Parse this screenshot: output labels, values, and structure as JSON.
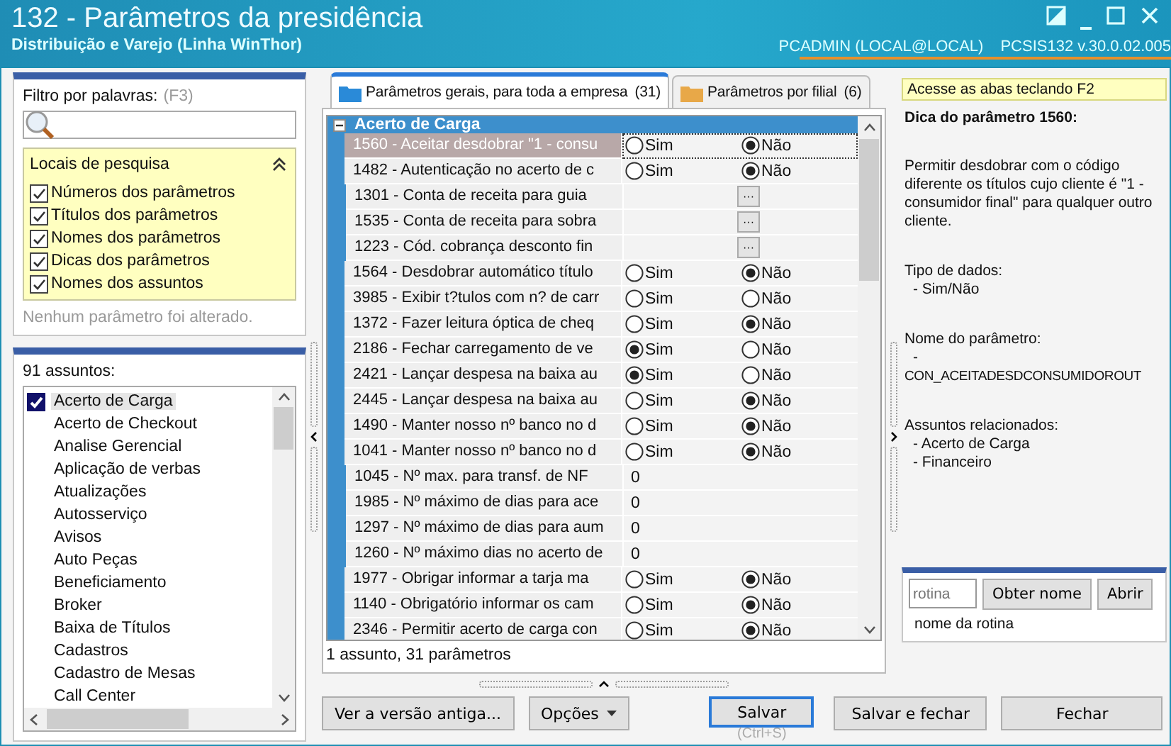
{
  "window": {
    "title": "132 - Parâmetros da presidência",
    "subtitle": "Distribuição e Varejo (Linha WinThor)",
    "user": "PCADMIN (LOCAL@LOCAL)",
    "program": "PCSIS132  v.30.0.02.005"
  },
  "filter": {
    "label": "Filtro por palavras:",
    "shortcut": "(F3)",
    "search_places": {
      "title": "Locais de pesquisa",
      "expanded": true,
      "options": [
        {
          "label": "Números dos parâmetros",
          "checked": true
        },
        {
          "label": "Títulos dos parâmetros",
          "checked": true
        },
        {
          "label": "Nomes dos parâmetros",
          "checked": true
        },
        {
          "label": "Dicas dos parâmetros",
          "checked": true
        },
        {
          "label": "Nomes dos assuntos",
          "checked": true
        }
      ]
    },
    "status": "Nenhum parâmetro foi alterado."
  },
  "subjects": {
    "count_label": "91 assuntos:",
    "items": [
      {
        "label": "Acerto de Carga",
        "checked": true,
        "selected": true
      },
      {
        "label": "Acerto de Checkout",
        "checked": false,
        "selected": false
      },
      {
        "label": "Analise Gerencial",
        "checked": false,
        "selected": false
      },
      {
        "label": "Aplicação de verbas",
        "checked": false,
        "selected": false
      },
      {
        "label": "Atualizações",
        "checked": false,
        "selected": false
      },
      {
        "label": "Autosserviço",
        "checked": false,
        "selected": false
      },
      {
        "label": "Avisos",
        "checked": false,
        "selected": false
      },
      {
        "label": "Auto Peças",
        "checked": false,
        "selected": false
      },
      {
        "label": "Beneficiamento",
        "checked": false,
        "selected": false
      },
      {
        "label": "Broker",
        "checked": false,
        "selected": false
      },
      {
        "label": "Baixa de Títulos",
        "checked": false,
        "selected": false
      },
      {
        "label": "Cadastros",
        "checked": false,
        "selected": false
      },
      {
        "label": "Cadastro de Mesas",
        "checked": false,
        "selected": false
      },
      {
        "label": "Call Center",
        "checked": false,
        "selected": false
      }
    ]
  },
  "tabs": [
    {
      "label": "Parâmetros gerais, para toda a empresa",
      "count": "(31)",
      "selected": true
    },
    {
      "label": "Parâmetros por filial",
      "count": "(6)",
      "selected": false
    }
  ],
  "grid": {
    "group": "Acerto de Carga",
    "expanded": true,
    "rows": [
      {
        "label": "1560 - Aceitar desdobrar \"1 - consu",
        "kind": "bool",
        "selected": true,
        "options": [
          {
            "label": "Sim",
            "selected": false
          },
          {
            "label": "Não",
            "selected": true
          }
        ]
      },
      {
        "label": "1482 - Autenticação no acerto de c",
        "kind": "bool",
        "selected": false,
        "options": [
          {
            "label": "Sim",
            "selected": false
          },
          {
            "label": "Não",
            "selected": true
          }
        ]
      },
      {
        "label": "1301 - Conta de receita para guia",
        "kind": "lookup",
        "selected": false,
        "button": "···"
      },
      {
        "label": "1535 - Conta de receita para sobra",
        "kind": "lookup",
        "selected": false,
        "button": "···"
      },
      {
        "label": "1223 - Cód. cobrança desconto fin",
        "kind": "lookup",
        "selected": false,
        "button": "···"
      },
      {
        "label": "1564 - Desdobrar automático título",
        "kind": "bool",
        "selected": false,
        "options": [
          {
            "label": "Sim",
            "selected": false
          },
          {
            "label": "Não",
            "selected": true
          }
        ]
      },
      {
        "label": "3985 - Exibir t?tulos com n? de carr",
        "kind": "bool",
        "selected": false,
        "options": [
          {
            "label": "Sim",
            "selected": false
          },
          {
            "label": "Não",
            "selected": false
          }
        ]
      },
      {
        "label": "1372 - Fazer leitura óptica de cheq",
        "kind": "bool",
        "selected": false,
        "options": [
          {
            "label": "Sim",
            "selected": false
          },
          {
            "label": "Não",
            "selected": true
          }
        ]
      },
      {
        "label": "2186 - Fechar carregamento de ve",
        "kind": "bool",
        "selected": false,
        "options": [
          {
            "label": "Sim",
            "selected": true
          },
          {
            "label": "Não",
            "selected": false
          }
        ]
      },
      {
        "label": "2421 - Lançar despesa na baixa au",
        "kind": "bool",
        "selected": false,
        "options": [
          {
            "label": "Sim",
            "selected": true
          },
          {
            "label": "Não",
            "selected": false
          }
        ]
      },
      {
        "label": "2445 - Lançar despesa na baixa au",
        "kind": "bool",
        "selected": false,
        "options": [
          {
            "label": "Sim",
            "selected": false
          },
          {
            "label": "Não",
            "selected": true
          }
        ]
      },
      {
        "label": "1490 - Manter nosso nº banco no d",
        "kind": "bool",
        "selected": false,
        "options": [
          {
            "label": "Sim",
            "selected": false
          },
          {
            "label": "Não",
            "selected": true
          }
        ]
      },
      {
        "label": "1041 - Manter nosso nº banco no d",
        "kind": "bool",
        "selected": false,
        "options": [
          {
            "label": "Sim",
            "selected": false
          },
          {
            "label": "Não",
            "selected": true
          }
        ]
      },
      {
        "label": "1045 - Nº max. para transf. de NF",
        "kind": "number",
        "selected": false,
        "value": "0"
      },
      {
        "label": "1985 - Nº máximo de dias para ace",
        "kind": "number",
        "selected": false,
        "value": "0"
      },
      {
        "label": "1297 - Nº máximo de dias para aum",
        "kind": "number",
        "selected": false,
        "value": "0"
      },
      {
        "label": "1260 - Nº máximo dias no acerto de",
        "kind": "number",
        "selected": false,
        "value": "0"
      },
      {
        "label": "1977 - Obrigar informar a tarja ma",
        "kind": "bool",
        "selected": false,
        "options": [
          {
            "label": "Sim",
            "selected": false
          },
          {
            "label": "Não",
            "selected": true
          }
        ]
      },
      {
        "label": "1140 - Obrigatório informar os cam",
        "kind": "bool",
        "selected": false,
        "options": [
          {
            "label": "Sim",
            "selected": false
          },
          {
            "label": "Não",
            "selected": true
          }
        ]
      },
      {
        "label": "2346 - Permitir acerto de carga con",
        "kind": "bool",
        "selected": false,
        "options": [
          {
            "label": "Sim",
            "selected": false
          },
          {
            "label": "Não",
            "selected": true
          }
        ]
      }
    ],
    "summary": "1 assunto, 31 parâmetros"
  },
  "buttons": [
    {
      "label": "Ver a versão antiga...",
      "kind": "plain"
    },
    {
      "label": "Opções",
      "kind": "menu"
    },
    {
      "label": "Salvar",
      "kind": "default",
      "shortcut": "(Ctrl+S)"
    },
    {
      "label": "Salvar e fechar",
      "kind": "plain"
    },
    {
      "label": "Fechar",
      "kind": "plain"
    }
  ],
  "hint_panel": {
    "notice": "Acesse as abas teclando F2",
    "title": "Dica do parâmetro 1560:",
    "description": "Permitir desdobrar com o código diferente os títulos cujo cliente é \"1 - consumidor final\" para qualquer outro cliente.",
    "sections": [
      {
        "heading": "Tipo de dados:",
        "lines": [
          "- Sim/Não"
        ]
      },
      {
        "heading": "Nome do parâmetro:",
        "lines": [
          "-",
          "CON_ACEITADESDCONSUMIDOROUT"
        ]
      },
      {
        "heading": "Assuntos relacionados:",
        "lines": [
          "- Acerto de Carga",
          "- Financeiro"
        ]
      }
    ]
  },
  "routine": {
    "placeholder": "rotina",
    "buttons": [
      "Obter nome",
      "Abrir"
    ],
    "name": "nome da rotina"
  }
}
